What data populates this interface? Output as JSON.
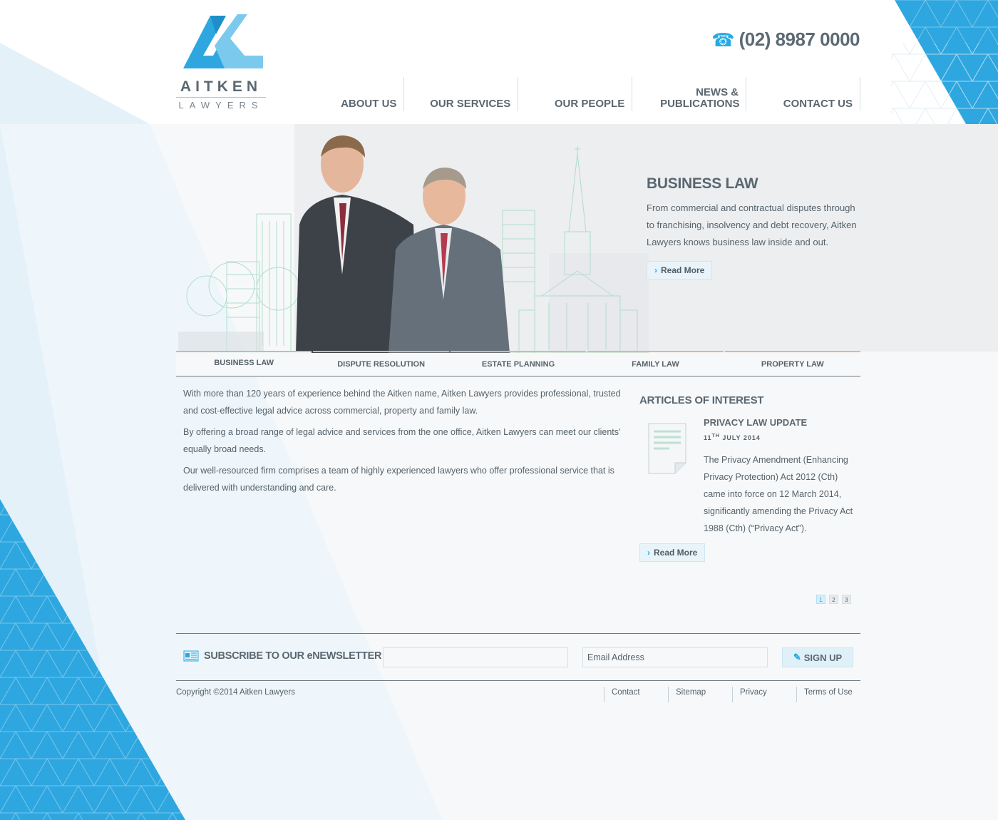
{
  "brand": {
    "name_top": "AITKEN",
    "name_bottom": "LAWYERS",
    "accent_color": "#29a9e1"
  },
  "header": {
    "phone_icon": "telephone-icon",
    "phone": "(02) 8987 0000"
  },
  "nav": {
    "items": [
      {
        "label": "ABOUT US"
      },
      {
        "label": "OUR SERVICES"
      },
      {
        "label": "OUR PEOPLE"
      },
      {
        "label": "NEWS & PUBLICATIONS"
      },
      {
        "label": "CONTACT US"
      }
    ]
  },
  "hero": {
    "title": "BUSINESS LAW",
    "text": "From commercial and contractual disputes through to franchising, insolvency and debt recovery, Aitken Lawyers knows business law inside and out.",
    "button": "Read More"
  },
  "tabs": {
    "items": [
      {
        "label": "BUSINESS LAW",
        "active": true
      },
      {
        "label": "DISPUTE RESOLUTION"
      },
      {
        "label": "ESTATE PLANNING"
      },
      {
        "label": "FAMILY LAW"
      },
      {
        "label": "PROPERTY LAW"
      }
    ]
  },
  "intro": {
    "paragraphs": [
      "With more than 120 years of experience behind the Aitken name, Aitken Lawyers provides professional, trusted and cost-effective legal advice across commercial, property and family law.",
      "By offering a broad range of legal advice and services from the one office, Aitken Lawyers can meet our clients’ equally broad needs.",
      "Our well-resourced firm comprises a team of highly experienced lawyers who offer professional service that is delivered with understanding and care."
    ]
  },
  "articles": {
    "heading": "ARTICLES OF INTEREST",
    "item": {
      "icon": "document-icon",
      "title": "PRIVACY LAW UPDATE",
      "date_day": "11",
      "date_suffix": "TH",
      "date_rest": "JULY 2014",
      "text": "The Privacy Amendment (Enhancing Privacy Protection) Act 2012 (Cth) came into force on 12 March 2014, significantly amending the Privacy Act 1988 (Cth) (“Privacy Act”).",
      "button": "Read More"
    },
    "pages": [
      "1",
      "2",
      "3"
    ]
  },
  "newsletter": {
    "label": "SUBSCRIBE TO OUR eNEWSLETTER",
    "name_value": "",
    "email_placeholder": "Email Address",
    "button": "SIGN UP"
  },
  "footer": {
    "copyright": "Copyright ©2014 Aitken Lawyers",
    "links": [
      "Contact",
      "Sitemap",
      "Privacy",
      "Terms of Use"
    ]
  }
}
